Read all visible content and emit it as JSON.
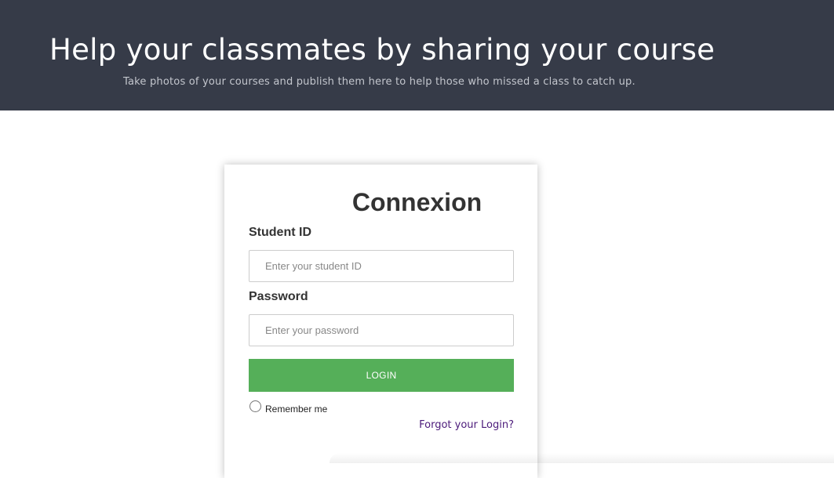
{
  "hero": {
    "title": "Help your classmates by sharing your course",
    "subtitle": "Take photos of your courses and publish them here to help those who missed a class to catch up.",
    "background_color": "#363b48"
  },
  "login_card": {
    "title": "Connexion",
    "student_id": {
      "label": "Student ID",
      "value": "",
      "placeholder": "Enter your student ID"
    },
    "password": {
      "label": "Password",
      "value": "",
      "placeholder": "Enter your password"
    },
    "login_button": {
      "label": "LOGIN",
      "color": "#55af59"
    },
    "remember_me": {
      "label": "Remember me",
      "checked": false
    },
    "forgot_link": {
      "label": "Forgot your Login?",
      "color": "#4b1a7a"
    }
  }
}
